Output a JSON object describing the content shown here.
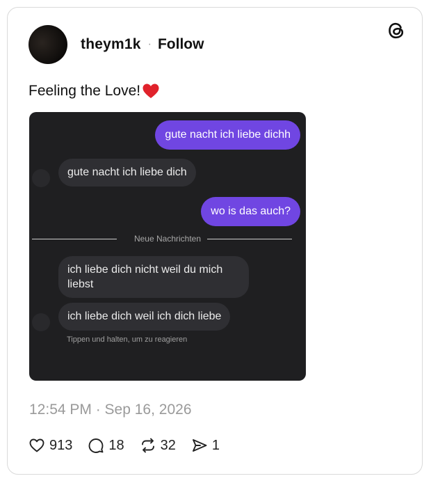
{
  "post": {
    "username": "theym1k",
    "separator": "·",
    "follow_label": "Follow",
    "caption": "Feeling the Love!",
    "timestamp": "12:54 PM · Sep 16, 2026"
  },
  "chat": {
    "messages": [
      {
        "direction": "outgoing",
        "text": "gute nacht ich liebe dichh"
      },
      {
        "direction": "incoming",
        "text": "gute nacht ich liebe dich"
      },
      {
        "direction": "outgoing",
        "text": "wo is das auch?"
      },
      {
        "direction": "incoming",
        "text": "ich liebe dich nicht weil du mich liebst"
      },
      {
        "direction": "incoming",
        "text": "ich liebe dich weil ich dich liebe"
      }
    ],
    "divider_label": "Neue Nachrichten",
    "hint": "Tippen und halten, um zu reagieren"
  },
  "actions": {
    "likes": "913",
    "replies": "18",
    "reposts": "32",
    "shares": "1"
  },
  "icons": {
    "brand": "threads-logo-icon",
    "caption_emoji": "red-heart-emoji",
    "like": "heart-icon",
    "reply": "comment-icon",
    "repost": "repost-icon",
    "share": "send-icon"
  },
  "colors": {
    "outgoing_bubble": "#7046e2",
    "incoming_bubble": "#2f2f33",
    "chat_background": "#1f1f21",
    "heart_red": "#e0222b"
  }
}
